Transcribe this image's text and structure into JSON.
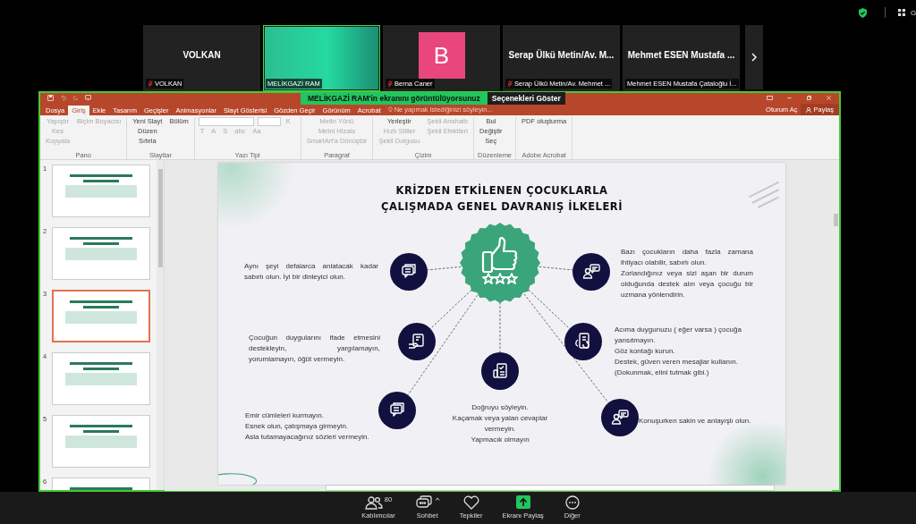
{
  "top_bar": {
    "label": "G"
  },
  "participants": [
    {
      "kind": "name",
      "display": "VOLKAN",
      "label": "VOLKAN",
      "muted": true,
      "speaking": false
    },
    {
      "kind": "video",
      "label": "MELİKGAZİ RAM",
      "muted": false,
      "speaking": true
    },
    {
      "kind": "avatar",
      "initial": "B",
      "label": "Berna Caner",
      "muted": true,
      "speaking": false
    },
    {
      "kind": "name",
      "display": "Serap Ülkü Metin/Av. M...",
      "label": "Serap Ülkü Metin/Av. Mehmet ...",
      "muted": true,
      "speaking": false
    },
    {
      "kind": "name",
      "display": "Mehmet ESEN Mustafa ...",
      "label": "Mehmet ESEN Mustafa Çataloğlu İ...",
      "muted": false,
      "speaking": false
    }
  ],
  "share_banner": {
    "message": "MELİKGAZİ RAM'in ekranını görüntülüyorsunuz",
    "options": "Seçenekleri Göster"
  },
  "tabs": [
    {
      "label": "Dosya",
      "selected": false
    },
    {
      "label": "Giriş",
      "selected": true
    },
    {
      "label": "Ekle",
      "selected": false
    },
    {
      "label": "Tasarım",
      "selected": false
    },
    {
      "label": "Geçişler",
      "selected": false
    },
    {
      "label": "Animasyonlar",
      "selected": false
    },
    {
      "label": "Slayt Gösterisi",
      "selected": false
    },
    {
      "label": "Gözden Geçir",
      "selected": false
    },
    {
      "label": "Görünüm",
      "selected": false
    },
    {
      "label": "Acrobat",
      "selected": false
    }
  ],
  "tell_me": {
    "placeholder": "Ne yapmak istediğinizi söyleyin..."
  },
  "account": {
    "sign_in": "Oturum Aç",
    "share": "Paylaş"
  },
  "ribbon": [
    {
      "label": "Pano",
      "items": [
        {
          "text": "Yapıştır",
          "disabled": true
        },
        {
          "text": "Kes",
          "disabled": true
        },
        {
          "text": "Kopyala",
          "disabled": true
        },
        {
          "text": "Biçim Boyacısı",
          "disabled": true
        }
      ]
    },
    {
      "label": "Slaytlar",
      "items": [
        {
          "text": "Yeni Slayt",
          "disabled": false
        },
        {
          "text": "Düzen",
          "disabled": false
        },
        {
          "text": "Sıfırla",
          "disabled": false
        },
        {
          "text": "Bölüm",
          "disabled": false
        }
      ]
    },
    {
      "label": "Yazı Tipi",
      "items": [
        {
          "text": "K",
          "disabled": true
        },
        {
          "text": "T",
          "disabled": true
        },
        {
          "text": "A",
          "disabled": true
        },
        {
          "text": "S",
          "disabled": true
        },
        {
          "text": "abc",
          "disabled": true
        },
        {
          "text": "Aa",
          "disabled": true
        }
      ]
    },
    {
      "label": "Paragraf",
      "items": [
        {
          "text": "Metin Yönü",
          "disabled": true
        },
        {
          "text": "Metni Hizala",
          "disabled": true
        },
        {
          "text": "SmartArt'a Dönüştür",
          "disabled": true
        }
      ]
    },
    {
      "label": "Çizim",
      "items": [
        {
          "text": "Yerleştir",
          "disabled": false
        },
        {
          "text": "Hızlı Stiller",
          "disabled": true
        },
        {
          "text": "Şekil Dolgusu",
          "disabled": true
        },
        {
          "text": "Şekil Anahattı",
          "disabled": true
        },
        {
          "text": "Şekil Efektleri",
          "disabled": true
        }
      ]
    },
    {
      "label": "Düzenleme",
      "items": [
        {
          "text": "Bul",
          "disabled": false
        },
        {
          "text": "Değiştir",
          "disabled": false
        },
        {
          "text": "Seç",
          "disabled": false
        }
      ]
    },
    {
      "label": "Adobe Acrobat",
      "items": [
        {
          "text": "PDF oluşturma",
          "disabled": false
        }
      ]
    }
  ],
  "thumbnails": [
    {
      "number": "1",
      "selected": false
    },
    {
      "number": "2",
      "selected": false
    },
    {
      "number": "3",
      "selected": true
    },
    {
      "number": "4",
      "selected": false
    },
    {
      "number": "5",
      "selected": false
    },
    {
      "number": "6",
      "selected": false
    }
  ],
  "slide": {
    "title": [
      "KRİZDEN ETKİLENEN ÇOCUKLARLA",
      "ÇALIŞMADA GENEL DAVRANIŞ İLKELERİ"
    ],
    "nodes": [
      {
        "lines": [
          "Aynı şeyi defalarca anlatacak kadar sabırlı olun. İyi bir dinleyici olun."
        ]
      },
      {
        "lines": [
          "Bazı çocukların daha fazla zamana ihtiyacı olabilir, sabırlı olun.",
          "Zorlandığınız veya sizi aşan bir durum olduğunda destek alın veya çocuğu bir uzmana yönlendirin."
        ]
      },
      {
        "lines": [
          "Çocuğun duygularını ifade etmesini destekleyin, yargılamayın, yorumlamayın, öğüt vermeyin."
        ]
      },
      {
        "lines": [
          "Acıma duygunuzu ( eğer varsa ) çocuğa yansıtmayın.",
          "Göz kontağı kurun.",
          "Destek, güven veren mesajlar kullanın. (Dokunmak, elini tutmak gibi.)"
        ]
      },
      {
        "lines": [
          "Emir cümleleri kurmayın.",
          "Esnek olun, çatışmaya girmeyin.",
          "Asla tutamayacağınız sözleri vermeyin."
        ]
      },
      {
        "lines": [
          "Doğruyu söyleyin.",
          "Kaçamak veya yalan cevaplar vermeyin.",
          "Yapmacık olmayın"
        ]
      },
      {
        "lines": [
          "Konuşurken sakin ve anlayışlı olun."
        ]
      }
    ]
  },
  "toolbar": [
    {
      "label": "Katılımcılar",
      "count": "80"
    },
    {
      "label": "Sohbet"
    },
    {
      "label": "Tepkiler"
    },
    {
      "label": "Ekranı Paylaş"
    },
    {
      "label": "Diğer"
    }
  ]
}
